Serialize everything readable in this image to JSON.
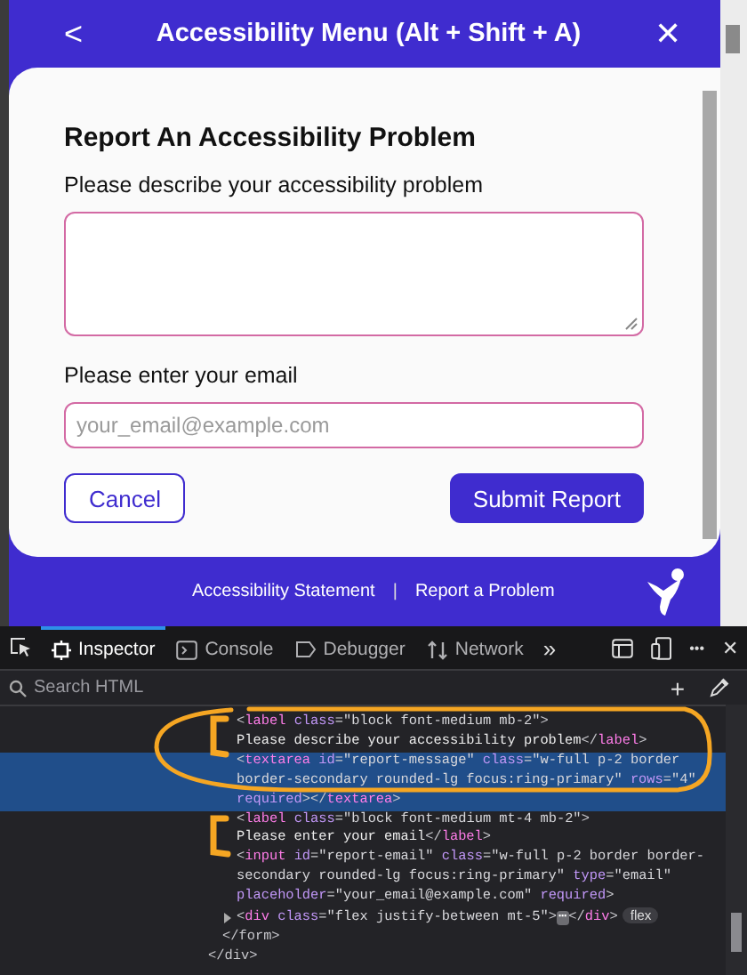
{
  "header": {
    "back": "<",
    "title": "Accessibility Menu (Alt + Shift + A)",
    "close": "✕"
  },
  "form": {
    "heading": "Report An Accessibility Problem",
    "message_label": "Please describe your accessibility problem",
    "email_label": "Please enter your email",
    "email_placeholder": "your_email@example.com",
    "buttons": [
      {
        "label": "Cancel",
        "kind": "outline"
      },
      {
        "label": "Submit Report",
        "kind": "primary"
      }
    ]
  },
  "footer": {
    "links": [
      "Accessibility Statement",
      "Report a Problem"
    ],
    "separator": "|"
  },
  "devtools": {
    "tabs": [
      {
        "label": "Inspector",
        "kind": "inspector",
        "selected": true
      },
      {
        "label": "Console",
        "kind": "console",
        "selected": false
      },
      {
        "label": "Debugger",
        "kind": "debugger",
        "selected": false
      },
      {
        "label": "Network",
        "kind": "network",
        "selected": false
      }
    ],
    "more_tabs": "»",
    "menu": "•••",
    "close": "✕",
    "search": {
      "placeholder": "Search HTML"
    },
    "add": "+",
    "tree": {
      "closing": "</div>",
      "children": [
        {
          "closing": "</form>",
          "children": [
            {
              "selected": false,
              "lines": [
                [
                  {
                    "kind": "p",
                    "t": "<"
                  },
                  {
                    "kind": "tag",
                    "t": "label"
                  },
                  {
                    "kind": "attr",
                    "t": " class"
                  },
                  {
                    "kind": "p",
                    "t": "="
                  },
                  {
                    "kind": "val",
                    "t": "\"block font-medium mb-2\""
                  },
                  {
                    "kind": "p",
                    "t": ">"
                  }
                ],
                [
                  {
                    "kind": "text",
                    "t": "Please describe your accessibility problem"
                  },
                  {
                    "kind": "p",
                    "t": "</"
                  },
                  {
                    "kind": "tag",
                    "t": "label"
                  },
                  {
                    "kind": "p",
                    "t": ">"
                  }
                ]
              ]
            },
            {
              "selected": true,
              "lines": [
                [
                  {
                    "kind": "p",
                    "t": "<"
                  },
                  {
                    "kind": "tag",
                    "t": "textarea"
                  },
                  {
                    "kind": "attr",
                    "t": " id"
                  },
                  {
                    "kind": "p",
                    "t": "="
                  },
                  {
                    "kind": "val",
                    "t": "\"report-message\""
                  },
                  {
                    "kind": "attr",
                    "t": " class"
                  },
                  {
                    "kind": "p",
                    "t": "="
                  },
                  {
                    "kind": "val",
                    "t": "\"w-full p-2 border"
                  }
                ],
                [
                  {
                    "kind": "val",
                    "t": "border-secondary rounded-lg focus:ring-primary\""
                  },
                  {
                    "kind": "attr",
                    "t": " rows"
                  },
                  {
                    "kind": "p",
                    "t": "="
                  },
                  {
                    "kind": "val",
                    "t": "\"4\""
                  }
                ],
                [
                  {
                    "kind": "attr",
                    "t": "required"
                  },
                  {
                    "kind": "p",
                    "t": "></"
                  },
                  {
                    "kind": "tag",
                    "t": "textarea"
                  },
                  {
                    "kind": "p",
                    "t": ">"
                  }
                ]
              ]
            },
            {
              "selected": false,
              "lines": [
                [
                  {
                    "kind": "p",
                    "t": "<"
                  },
                  {
                    "kind": "tag",
                    "t": "label"
                  },
                  {
                    "kind": "attr",
                    "t": " class"
                  },
                  {
                    "kind": "p",
                    "t": "="
                  },
                  {
                    "kind": "val",
                    "t": "\"block font-medium mt-4 mb-2\""
                  },
                  {
                    "kind": "p",
                    "t": ">"
                  }
                ],
                [
                  {
                    "kind": "text",
                    "t": "Please enter your email"
                  },
                  {
                    "kind": "p",
                    "t": "</"
                  },
                  {
                    "kind": "tag",
                    "t": "label"
                  },
                  {
                    "kind": "p",
                    "t": ">"
                  }
                ]
              ]
            },
            {
              "selected": false,
              "lines": [
                [
                  {
                    "kind": "p",
                    "t": "<"
                  },
                  {
                    "kind": "tag",
                    "t": "input"
                  },
                  {
                    "kind": "attr",
                    "t": " id"
                  },
                  {
                    "kind": "p",
                    "t": "="
                  },
                  {
                    "kind": "val",
                    "t": "\"report-email\""
                  },
                  {
                    "kind": "attr",
                    "t": " class"
                  },
                  {
                    "kind": "p",
                    "t": "="
                  },
                  {
                    "kind": "val",
                    "t": "\"w-full p-2 border border-"
                  }
                ],
                [
                  {
                    "kind": "val",
                    "t": "secondary rounded-lg focus:ring-primary\""
                  },
                  {
                    "kind": "attr",
                    "t": " type"
                  },
                  {
                    "kind": "p",
                    "t": "="
                  },
                  {
                    "kind": "val",
                    "t": "\"email\""
                  }
                ],
                [
                  {
                    "kind": "attr",
                    "t": "placeholder"
                  },
                  {
                    "kind": "p",
                    "t": "="
                  },
                  {
                    "kind": "val",
                    "t": "\"your_email@example.com\""
                  },
                  {
                    "kind": "attr",
                    "t": " required"
                  },
                  {
                    "kind": "p",
                    "t": ">"
                  }
                ]
              ]
            },
            {
              "selected": false,
              "expanded": false,
              "badge": "flex",
              "lines": [
                [
                  {
                    "kind": "p",
                    "t": "<"
                  },
                  {
                    "kind": "tag",
                    "t": "div"
                  },
                  {
                    "kind": "attr",
                    "t": " class"
                  },
                  {
                    "kind": "p",
                    "t": "="
                  },
                  {
                    "kind": "val",
                    "t": "\"flex justify-between mt-5\""
                  },
                  {
                    "kind": "p",
                    "t": ">"
                  },
                  {
                    "kind": "ellipsis",
                    "t": "⋯"
                  },
                  {
                    "kind": "p",
                    "t": "</"
                  },
                  {
                    "kind": "tag",
                    "t": "div"
                  },
                  {
                    "kind": "p",
                    "t": ">"
                  }
                ]
              ]
            }
          ]
        }
      ]
    }
  }
}
